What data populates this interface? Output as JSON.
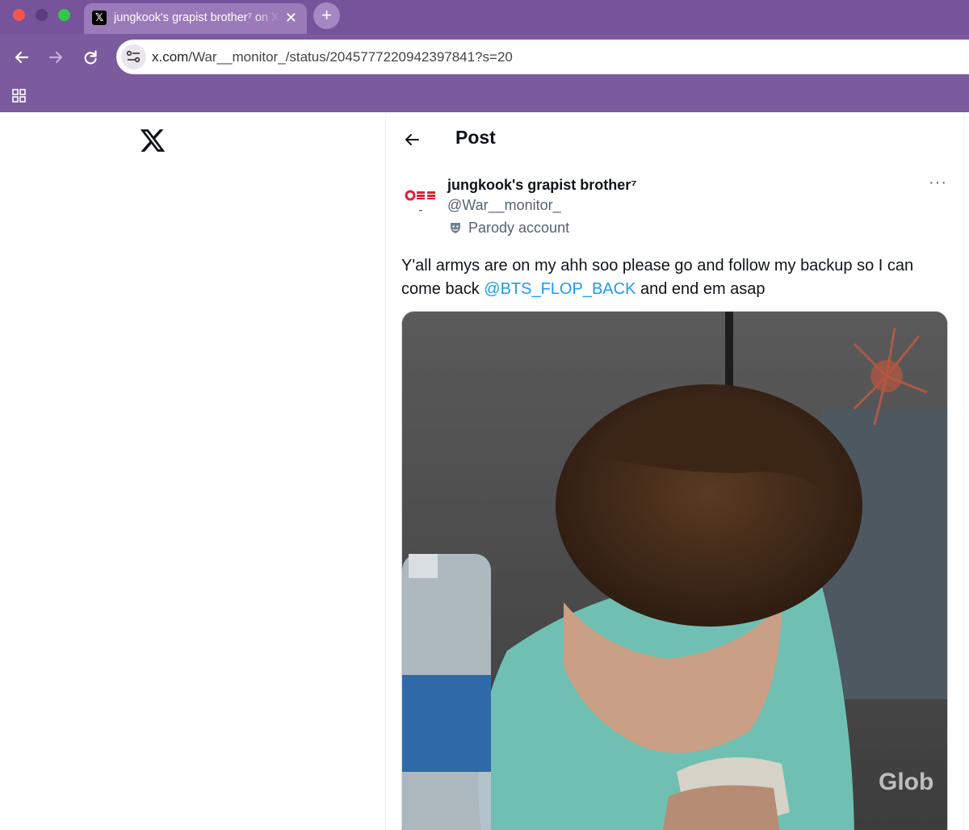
{
  "browser": {
    "tab": {
      "title": "jungkook's grapist brother⁷ on X",
      "favicon": "x-logo-icon"
    },
    "new_tab_label": "+",
    "close_label": "✕",
    "url": {
      "host": "x.com",
      "path": "/War__monitor_/status/2045777220942397841?s=20"
    }
  },
  "header": {
    "title": "Post"
  },
  "tweet": {
    "display_name": "jungkook's grapist brother⁷",
    "handle": "@War__monitor_",
    "parody_label": "Parody account",
    "text_before": "Y'all armys are on my ahh soo please go and follow my backup so I can come back ",
    "mention": "@BTS_FLOP_BACK",
    "text_after": " and end em asap",
    "more_label": "···",
    "media_watermark": "Glob"
  },
  "colors": {
    "accent": "#1d9bf0",
    "browser_frame": "#7b5a9e",
    "text_secondary": "#536471"
  }
}
